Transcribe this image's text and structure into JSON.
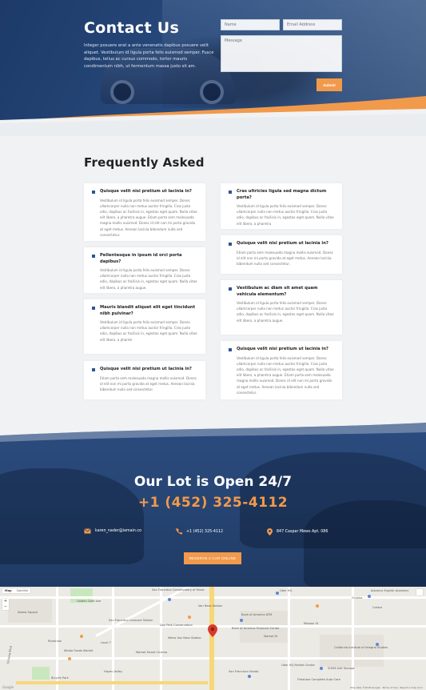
{
  "contact": {
    "title": "Contact Us",
    "text": "Integer posuere erat a ante venenatis dapibus posuere velit aliquet. Vestibulum id ligula porta felis euismod semper. Fusce dapibus, tellus ac cursus commodo, tortor mauris condimentum nibh, ut fermentum massa justo sit am.",
    "name_placeholder": "Name",
    "email_placeholder": "Email Address",
    "message_placeholder": "Message",
    "submit_label": "Submit"
  },
  "faq": {
    "title": "Frequently Asked",
    "left": [
      {
        "q": "Quisque velit nisi pretium ut lacinia in?",
        "a": "Vestibulum id ligula porta felis euismod semper. Donec ullamcorper nulla non metus auctor fringilla. Cras justo odio, dapibus ac facilisis in, egestas eget quam. Nulla vitae elit libero, a pharetra augue. Etiam porta sem malesuada magna mollis euismod. Donec id elit non mi porta gravida at eget metus. Aenean lacinia bibendum nulla sed consectetur."
      },
      {
        "q": "Pellentesque in ipsum id orci porta dapibus?",
        "a": "Vestibulum id ligula porta felis euismod semper. Donec ullamcorper nulla non metus auctor fringilla. Cras justo odio, dapibus ac facilisis in, egestas eget quam. Nulla vitae elit libero, a pharetra augue."
      },
      {
        "q": "Mauris blandit aliquet elit eget tincidunt nibh pulvinar?",
        "a": "Vestibulum id ligula porta felis euismod semper. Donec ullamcorper nulla non metus auctor fringilla. Cras justo odio, dapibus ac facilisis in, egestas eget quam. Nulla vitae elit libero, a pharetr"
      },
      {
        "q": "Quisque velit nisi pretium ut lacinia in?",
        "a": "Etiam porta sem malesuada magna mollis euismod. Donec id elit non mi porta gravida at eget metus. Aenean lacinia bibendum nulla sed consectetur."
      }
    ],
    "right": [
      {
        "q": "Cras ultricies ligula sed magna dictum porta?",
        "a": "Vestibulum id ligula porta felis euismod semper. Donec ullamcorper nulla non metus auctor fringilla. Cras justo odio, dapibus ac facilisis in, egestas eget quam. Nulla vitae elit libero, a pharetra"
      },
      {
        "q": "Quisque velit nisi pretium ut lacinia in?",
        "a": "Etiam porta sem malesuada magna mollis euismod. Donec id elit non mi porta gravida at eget metus. Aenean lacinia bibendum nulla sed consectetur."
      },
      {
        "q": "Vestibulum ac diam sit amet quam vehicula elementum?",
        "a": "Vestibulum id ligula porta felis euismod semper. Donec ullamcorper nulla non metus auctor fringilla. Cras justo odio, dapibus ac facilisis in, egestas eget quam. Nulla vitae elit libero, a pharetra augue."
      },
      {
        "q": "Quisque velit nisi pretium ut lacinia in?",
        "a": "Vestibulum id ligula porta felis euismod semper. Donec ullamcorper nulla non metus auctor fringilla. Cras justo odio, dapibus ac facilisis in, egestas eget quam. Nulla vitae elit libero, a pharetra augue. Etiam porta sem malesuada magna mollis euismod. Donec id elit non mi porta gravida at eget metus. Aenean lacinia bibendum nulla sed consectetur."
      }
    ]
  },
  "lot": {
    "title": "Our Lot is Open 24/7",
    "phone": "+1 (452) 325-4112",
    "email": "karen_nader@iamain.co",
    "phone_small": "+1 (452) 325-4112",
    "address": "847 Caspar Mews Apt. 086",
    "reserve_label": "RESERVE A CAR ONLINE"
  },
  "map": {
    "map_label": "Map",
    "satellite_label": "Satellite",
    "labels": [
      "San Francisco Conservatory of Music",
      "Uber HQ",
      "Advance English Academy",
      "Van Ness Station",
      "Bank of America ATM",
      "San Francisco Carousel Station",
      "Day Park Conservation",
      "Metro Van Ness Station",
      "Market Street Cinema",
      "Chukka",
      "Costco",
      "Bank of America Financial Center",
      "California Institute of Integral Studies",
      "Rickshaw",
      "Whole Foods Market",
      "Alamo Square",
      "Golden Gate Ave",
      "Market St",
      "Mission St",
      "Octavia Blvd",
      "Level 7",
      "SOMA Self Storage",
      "Uber HQ Market Center",
      "San Francisco Honda",
      "Firestone Complete Auto Care",
      "Hayes Valley",
      "Bicycle Park"
    ],
    "footer": "Map data ©2018 Google · Terms of Use · Report a map error",
    "zoom_in": "+",
    "zoom_out": "−"
  },
  "colors": {
    "accent": "#f29a4b",
    "navy": "#1d3a68",
    "bullet": "#2d5597"
  }
}
